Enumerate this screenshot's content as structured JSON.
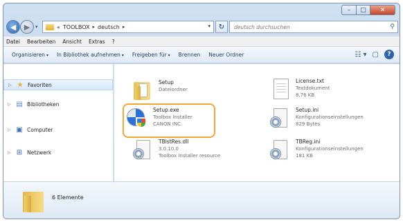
{
  "window": {
    "controls": {
      "minimize": "–",
      "maximize": "□",
      "close": "✕"
    }
  },
  "address": {
    "overflow": "«",
    "crumbs": [
      "TOOLBOX",
      "deutsch"
    ],
    "separator": "▸",
    "refresh": "↻",
    "search_placeholder": "deutsch durchsuchen"
  },
  "menu": [
    "Datei",
    "Bearbeiten",
    "Ansicht",
    "Extras",
    "?"
  ],
  "toolbar": {
    "organize": "Organisieren",
    "library": "In Bibliothek aufnehmen",
    "share": "Freigeben für",
    "burn": "Brennen",
    "new_folder": "Neuer Ordner",
    "caret": "▾"
  },
  "nav": [
    {
      "label": "Favoriten",
      "icon": "star-icon"
    },
    {
      "label": "Bibliotheken",
      "icon": "library-icon"
    },
    {
      "label": "Computer",
      "icon": "computer-icon"
    },
    {
      "label": "Netzwerk",
      "icon": "network-icon"
    }
  ],
  "files": [
    {
      "name": "Setup",
      "lines": [
        "Dateiordner"
      ],
      "icon": "folder-icon"
    },
    {
      "name": "License.txt",
      "lines": [
        "Textdokument",
        "8,76 KB"
      ],
      "icon": "text-document-icon"
    },
    {
      "name": "Setup.exe",
      "lines": [
        "Toolbox Installer",
        "CANON INC."
      ],
      "icon": "setup-installer-icon"
    },
    {
      "name": "Setup.ini",
      "lines": [
        "Konfigurationseinstellungen",
        "829 Bytes"
      ],
      "icon": "config-file-icon"
    },
    {
      "name": "TBlstRes.dll",
      "lines": [
        "3.0.10.0",
        "Toolbox Installer resource"
      ],
      "icon": "dll-file-icon"
    },
    {
      "name": "TBReg.ini",
      "lines": [
        "Konfigurationseinstellungen",
        "181 KB"
      ],
      "icon": "config-file-icon"
    }
  ],
  "details": {
    "count": "6 Elemente"
  },
  "colors": {
    "highlight": "#f2a735",
    "accent": "#2d64ad"
  }
}
